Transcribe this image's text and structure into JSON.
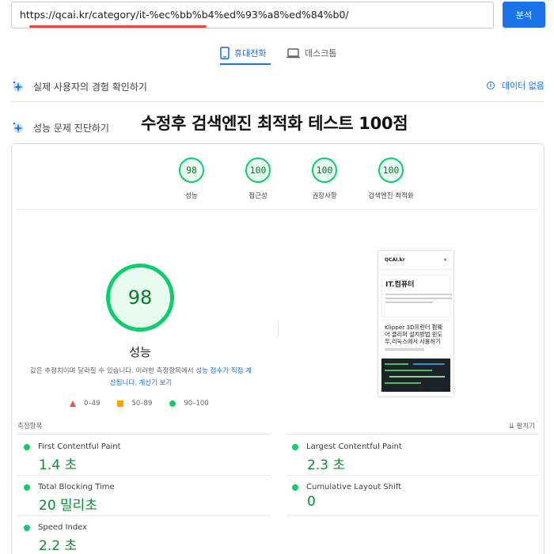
{
  "url_bar": {
    "url": "https://qcai.kr/category/it-%ec%bb%b4%ed%93%a8%ed%84%b0/",
    "analyze_label": "분석"
  },
  "device_tabs": {
    "mobile_label": "휴대전화",
    "desktop_label": "데스크톱"
  },
  "field_data": {
    "label": "실제 사용자의 경험 확인하기",
    "no_data_label": "데이터 없음"
  },
  "diagnose": {
    "label": "성능 문제 진단하기"
  },
  "overlay_title": "수정후 검색엔진 최적화 테스트 100점",
  "category_scores": [
    {
      "score": "98",
      "label": "성능"
    },
    {
      "score": "100",
      "label": "접근성"
    },
    {
      "score": "100",
      "label": "권장사항"
    },
    {
      "score": "100",
      "label": "검색엔진 최적화"
    }
  ],
  "performance": {
    "score": "98",
    "label": "성능",
    "note_prefix": "값은 추정치이며 달라질 수 있습니다. 이러한 측정항목에서 ",
    "note_link1": "성능 점수가 직접 계산됩니다",
    "note_middle": ". ",
    "note_link2": "계산기 보기",
    "legend": {
      "fail": "0–49",
      "average": "50–89",
      "pass": "90–100"
    }
  },
  "screenshot": {
    "site_name": "QCAI.kr",
    "close": "×",
    "heading": "IT.컴퓨터",
    "post_title": "Klipper 3D프린터 펌웨어 클리퍼 설치방법 윈도우,리눅스에서 사용하기"
  },
  "metrics": {
    "section_label": "측정항목",
    "expand_label": "⇊ 펼치기",
    "items": [
      {
        "name": "First Contentful Paint",
        "value": "1.4 초"
      },
      {
        "name": "Largest Contentful Paint",
        "value": "2.3 초"
      },
      {
        "name": "Total Blocking Time",
        "value": "20 밀리초"
      },
      {
        "name": "Cumulative Layout Shift",
        "value": "0"
      },
      {
        "name": "Speed Index",
        "value": "2.2 초"
      }
    ]
  },
  "colors": {
    "accent": "#1a73e8",
    "pass": "#0cce6b",
    "average": "#ffa400",
    "fail": "#ff4e42",
    "pass_text": "#0a8a30"
  }
}
